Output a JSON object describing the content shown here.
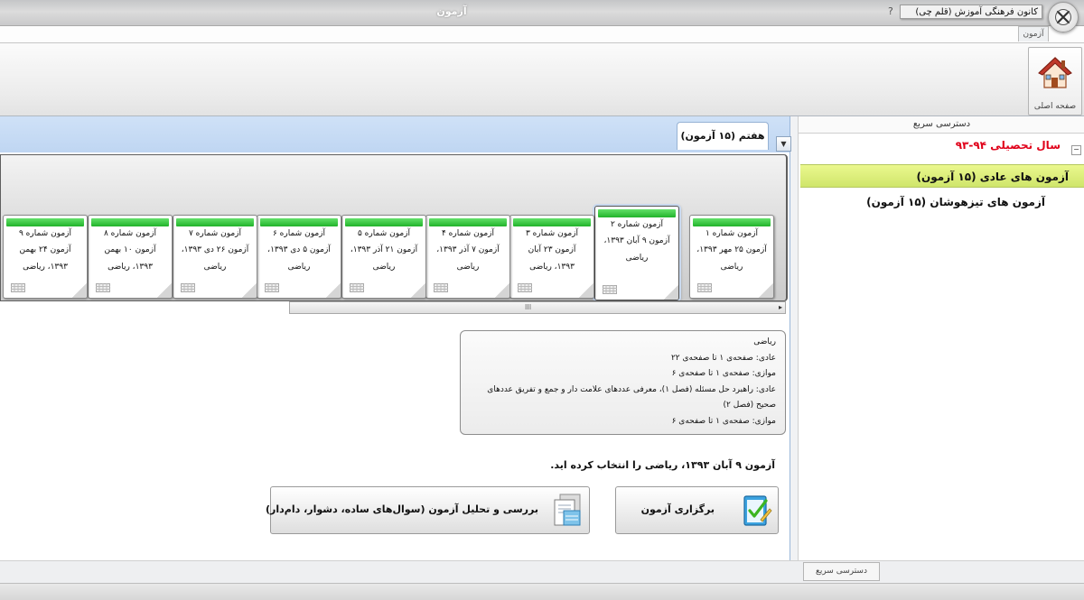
{
  "window": {
    "title": "آزمون",
    "tooltip": "کانون فرهنگی آموزش (قلم چی)",
    "qa_button": "?"
  },
  "ribbon": {
    "tab_label": "آزمون",
    "home_label": "صفحه اصلی"
  },
  "main": {
    "group_tab": "هفتم (۱۵ آزمون)",
    "cards": [
      {
        "title": "آزمون شماره ۱",
        "line1": "آزمون ۲۵ مهر ۱۳۹۳،",
        "line2": "ریاضی"
      },
      {
        "title": "آزمون شماره ۲",
        "line1": "آزمون ۹ آبان ۱۳۹۳،",
        "line2": "ریاضی"
      },
      {
        "title": "آزمون شماره ۳",
        "line1": "آزمون ۲۳ آبان",
        "line2": "۱۳۹۳، ریاضی"
      },
      {
        "title": "آزمون شماره ۴",
        "line1": "آزمون ۷ آذر ۱۳۹۳،",
        "line2": "ریاضی"
      },
      {
        "title": "آزمون شماره ۵",
        "line1": "آزمون ۲۱ آذر ۱۳۹۳،",
        "line2": "ریاضی"
      },
      {
        "title": "آزمون شماره ۶",
        "line1": "آزمون ۵ دی ۱۳۹۳،",
        "line2": "ریاضی"
      },
      {
        "title": "آزمون شماره ۷",
        "line1": "آزمون ۲۶ دی ۱۳۹۳،",
        "line2": "ریاضی"
      },
      {
        "title": "آزمون شماره ۸",
        "line1": "آزمون ۱۰ بهمن",
        "line2": "۱۳۹۳، ریاضی"
      },
      {
        "title": "آزمون شماره ۹",
        "line1": "آزمون ۲۴ بهمن",
        "line2": "۱۳۹۳، ریاضی"
      }
    ],
    "scroll_grip": "III",
    "scroll_arrow": "▸",
    "description": [
      "ریاضی",
      "عادی: صفحه‌ی ۱ تا صفحه‌ی ۲۲",
      "موازی: صفحه‌ی ۱ تا صفحه‌ی ۶",
      "عادی: راهبرد حل مسئله (فصل ۱)، معرفی عددهای علامت دار و جمع و تفریق عددهای",
      "صحیح (فصل ۲)",
      "موازی: صفحه‌ی ۱ تا صفحه‌ی ۶"
    ],
    "status_message": "آزمون ۹ آبان ۱۳۹۳، ریاضی را انتخاب کرده اید.",
    "hold_exam_button": "برگزاری آزمون",
    "analysis_button": "بررسی و تحلیل آزمون (سوال‌های ساده، دشوار، دام‌دار)"
  },
  "right_panel": {
    "header": "دسترسی سریع",
    "year_label": "سال تحصیلی ۹۴-۹۳",
    "tree_toggle": "−",
    "items": [
      "آزمون های عادی (۱۵ آزمون)",
      "آزمون های تیزهوشان (۱۵ آزمون)"
    ],
    "bottom_tab": "دسترسی سریع"
  }
}
